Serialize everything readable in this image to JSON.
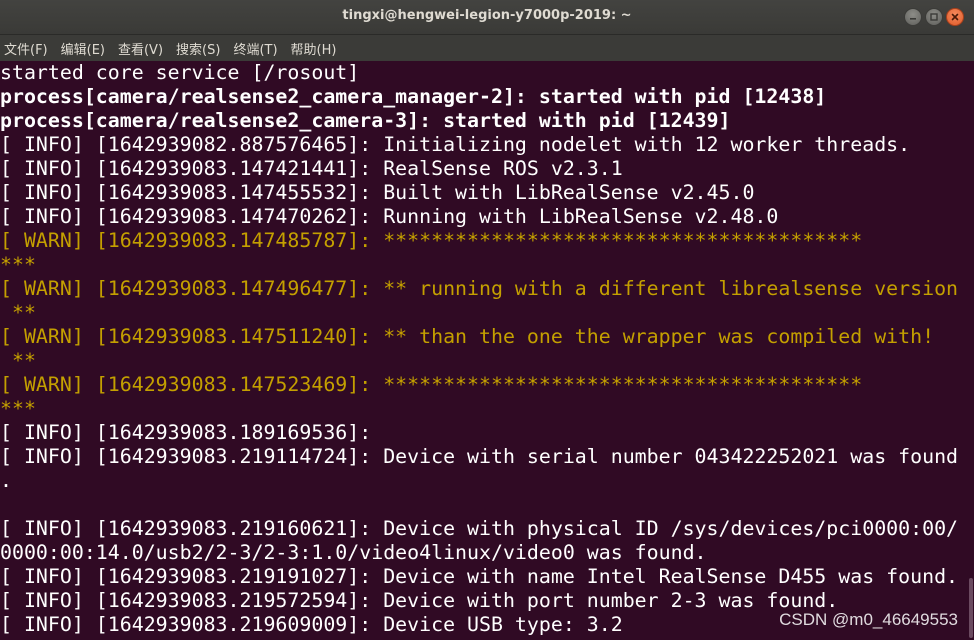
{
  "window": {
    "title": "tingxi@hengwei-legion-y7000p-2019: ~"
  },
  "menu": {
    "items": [
      "文件(F)",
      "编辑(E)",
      "查看(V)",
      "搜索(S)",
      "终端(T)",
      "帮助(H)"
    ]
  },
  "terminal": {
    "lines": [
      {
        "text": "started core service [/rosout]",
        "style": "normal"
      },
      {
        "text": "process[camera/realsense2_camera_manager-2]: started with pid [12438]",
        "style": "bold"
      },
      {
        "text": "process[camera/realsense2_camera-3]: started with pid [12439]",
        "style": "bold"
      },
      {
        "text": "[ INFO] [1642939082.887576465]: Initializing nodelet with 12 worker threads.",
        "style": "normal"
      },
      {
        "text": "[ INFO] [1642939083.147421441]: RealSense ROS v2.3.1",
        "style": "normal"
      },
      {
        "text": "[ INFO] [1642939083.147455532]: Built with LibRealSense v2.45.0",
        "style": "normal"
      },
      {
        "text": "[ INFO] [1642939083.147470262]: Running with LibRealSense v2.48.0",
        "style": "normal"
      },
      {
        "text": "[ WARN] [1642939083.147485787]: ****************************************",
        "style": "warn"
      },
      {
        "text": "***",
        "style": "warn"
      },
      {
        "text": "[ WARN] [1642939083.147496477]: ** running with a different librealsense version",
        "style": "warn"
      },
      {
        "text": " **",
        "style": "warn"
      },
      {
        "text": "[ WARN] [1642939083.147511240]: ** than the one the wrapper was compiled with!",
        "style": "warn"
      },
      {
        "text": " **",
        "style": "warn"
      },
      {
        "text": "[ WARN] [1642939083.147523469]: ****************************************",
        "style": "warn"
      },
      {
        "text": "***",
        "style": "warn"
      },
      {
        "text": "[ INFO] [1642939083.189169536]:",
        "style": "normal"
      },
      {
        "text": "[ INFO] [1642939083.219114724]: Device with serial number 043422252021 was found",
        "style": "normal"
      },
      {
        "text": ".",
        "style": "normal"
      },
      {
        "text": "",
        "style": "normal"
      },
      {
        "text": "[ INFO] [1642939083.219160621]: Device with physical ID /sys/devices/pci0000:00/",
        "style": "normal"
      },
      {
        "text": "0000:00:14.0/usb2/2-3/2-3:1.0/video4linux/video0 was found.",
        "style": "normal"
      },
      {
        "text": "[ INFO] [1642939083.219191027]: Device with name Intel RealSense D455 was found.",
        "style": "normal"
      },
      {
        "text": "[ INFO] [1642939083.219572594]: Device with port number 2-3 was found.",
        "style": "normal"
      },
      {
        "text": "[ INFO] [1642939083.219609009]: Device USB type: 3.2",
        "style": "normal"
      }
    ]
  },
  "watermark": "CSDN @m0_46649553",
  "colors": {
    "background": "#300a24",
    "text": "#ffffff",
    "warn": "#c4a000",
    "titlebar": "#3c3b37",
    "close_button": "#e95420"
  },
  "icons": [
    "minimize-icon",
    "maximize-icon",
    "close-icon"
  ]
}
